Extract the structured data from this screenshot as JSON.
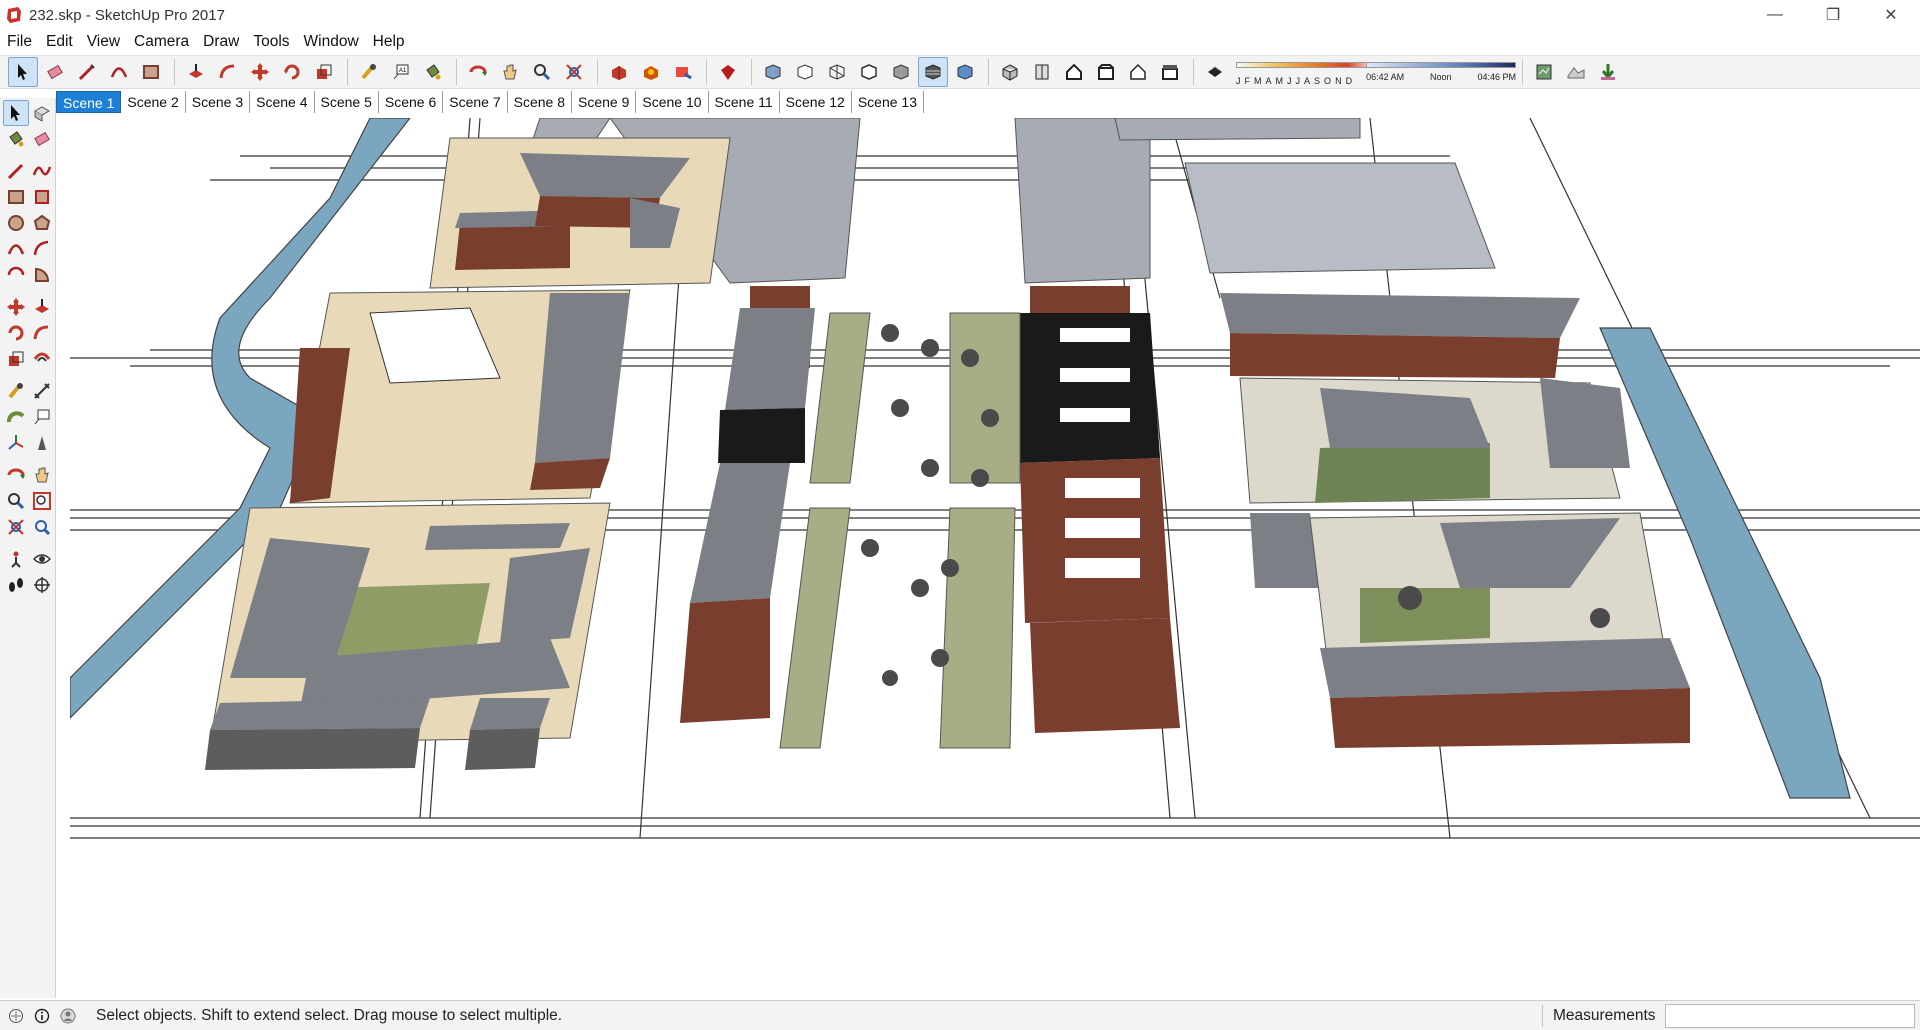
{
  "window": {
    "title": "232.skp - SketchUp Pro 2017",
    "minimize_glyph": "—",
    "restore_glyph": "❐",
    "close_glyph": "✕"
  },
  "menu": [
    "File",
    "Edit",
    "View",
    "Camera",
    "Draw",
    "Tools",
    "Window",
    "Help"
  ],
  "toolbar": {
    "month_labels": [
      "J",
      "F",
      "M",
      "A",
      "M",
      "J",
      "J",
      "A",
      "S",
      "O",
      "N",
      "D"
    ],
    "time_start": "06:42 AM",
    "time_mid": "Noon",
    "time_end": "04:46 PM"
  },
  "scenes": {
    "active_index": 0,
    "tabs": [
      "Scene 1",
      "Scene 2",
      "Scene 3",
      "Scene 4",
      "Scene 5",
      "Scene 6",
      "Scene 7",
      "Scene 8",
      "Scene 9",
      "Scene 10",
      "Scene 11",
      "Scene 12",
      "Scene 13"
    ]
  },
  "status": {
    "hint": "Select objects. Shift to extend select. Drag mouse to select multiple.",
    "measurements_label": "Measurements",
    "measurements_value": ""
  },
  "colors": {
    "accent": "#1e7fd6",
    "roof_gray": "#7c7f86",
    "brick": "#7a3e2e",
    "water": "#7aa6bf",
    "ground_tan": "#e8d9b9",
    "grass": "#7f8f5b"
  }
}
